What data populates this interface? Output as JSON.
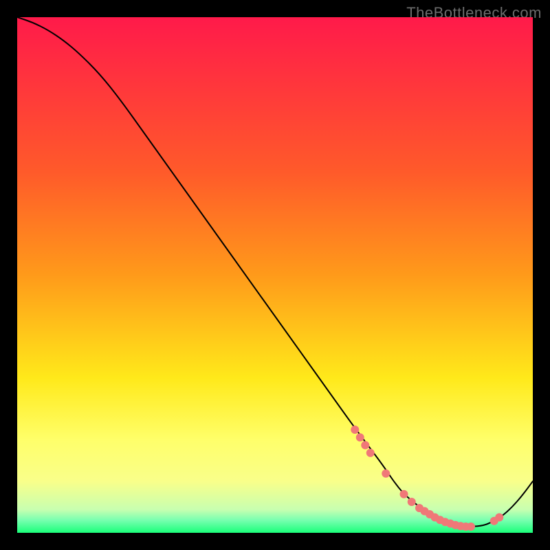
{
  "watermark": "TheBottleneck.com",
  "chart_data": {
    "type": "line",
    "title": "",
    "xlabel": "",
    "ylabel": "",
    "xlim": [
      0,
      100
    ],
    "ylim": [
      0,
      100
    ],
    "background_gradient": {
      "top": "#ff1a4a",
      "mid_upper": "#ff9a1a",
      "mid": "#ffe91a",
      "mid_lower": "#f9ff8a",
      "bottom": "#1aff7a"
    },
    "curve": {
      "color": "#000000",
      "width": 2,
      "x": [
        0,
        3,
        6,
        9,
        12,
        16,
        20,
        25,
        30,
        35,
        40,
        45,
        50,
        55,
        60,
        65,
        68,
        71,
        73,
        75,
        78,
        81,
        84,
        87,
        90,
        92,
        94,
        96,
        98,
        100
      ],
      "y": [
        100,
        99,
        97.5,
        95.5,
        93,
        89,
        84,
        77,
        70,
        63,
        56,
        49,
        42,
        35,
        28,
        21,
        17,
        13,
        10,
        7.5,
        5,
        3,
        1.8,
        1.2,
        1.3,
        2,
        3.2,
        5,
        7.3,
        10
      ]
    },
    "markers": {
      "shape": "circle",
      "color": "#f07878",
      "radius": 6,
      "x": [
        65.5,
        66.5,
        67.5,
        68.5,
        71.5,
        75,
        76.5,
        78,
        79,
        80,
        81,
        82,
        83,
        84,
        85,
        86,
        87,
        88,
        92.5,
        93.5
      ],
      "y": [
        20,
        18.5,
        17,
        15.5,
        11.5,
        7.5,
        6,
        4.8,
        4.2,
        3.6,
        3,
        2.5,
        2.1,
        1.8,
        1.5,
        1.3,
        1.2,
        1.2,
        2.3,
        3
      ]
    }
  }
}
